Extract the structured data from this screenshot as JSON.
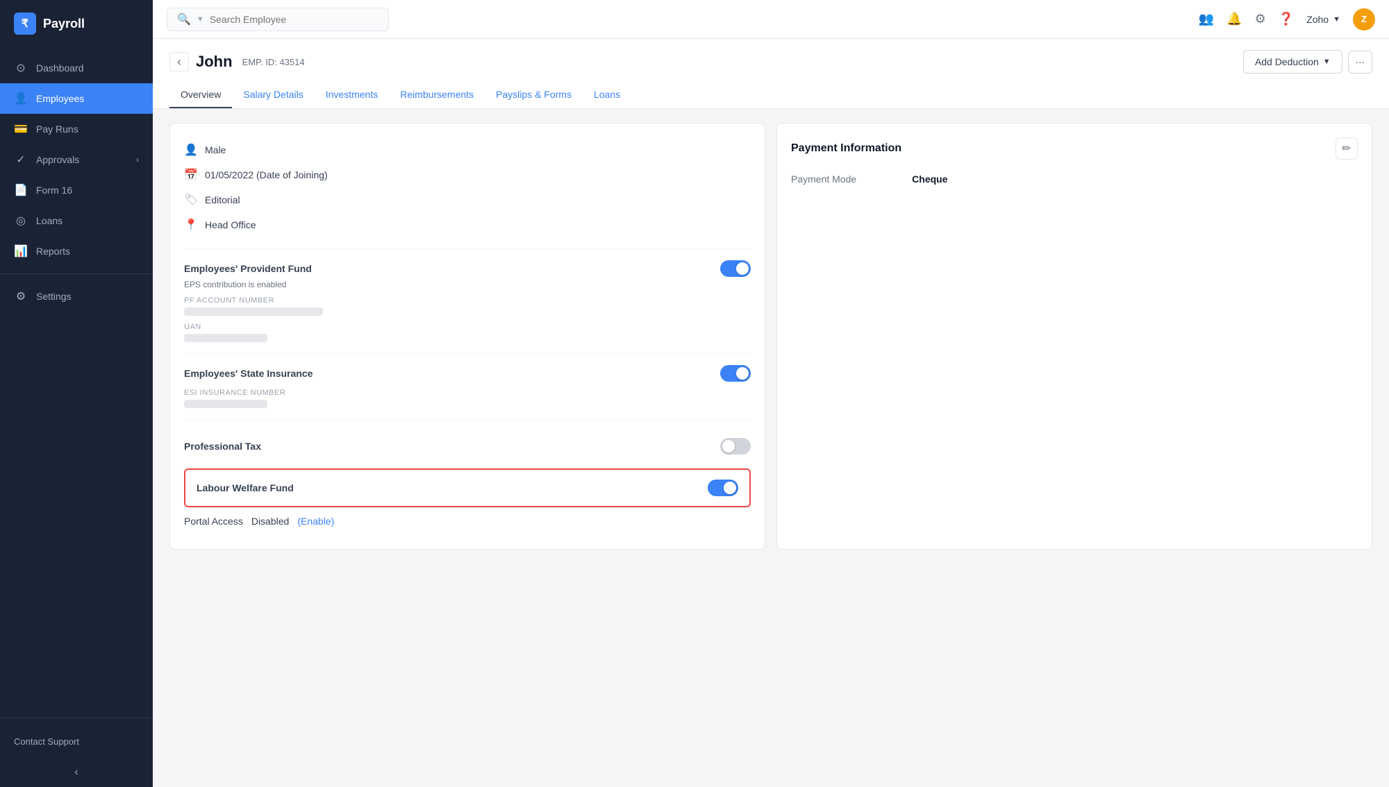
{
  "app": {
    "logo_text": "Payroll",
    "logo_icon": "₹"
  },
  "sidebar": {
    "items": [
      {
        "id": "dashboard",
        "label": "Dashboard",
        "icon": "⊙",
        "active": false
      },
      {
        "id": "employees",
        "label": "Employees",
        "icon": "👤",
        "active": true
      },
      {
        "id": "pay-runs",
        "label": "Pay Runs",
        "icon": "💳",
        "active": false
      },
      {
        "id": "approvals",
        "label": "Approvals",
        "icon": "✓",
        "active": false,
        "has_arrow": true
      },
      {
        "id": "form-16",
        "label": "Form 16",
        "icon": "📄",
        "active": false
      },
      {
        "id": "loans",
        "label": "Loans",
        "icon": "◎",
        "active": false
      },
      {
        "id": "reports",
        "label": "Reports",
        "icon": "📊",
        "active": false
      },
      {
        "id": "settings",
        "label": "Settings",
        "icon": "⚙",
        "active": false
      }
    ],
    "contact_support": "Contact Support",
    "collapse_icon": "‹"
  },
  "topbar": {
    "search_placeholder": "Search Employee",
    "user_label": "Zoho",
    "user_avatar": "Z"
  },
  "employee": {
    "name": "John",
    "emp_id_label": "EMP. ID: 43514",
    "back_icon": "‹"
  },
  "header_actions": {
    "add_deduction_label": "Add Deduction",
    "more_icon": "···"
  },
  "tabs": [
    {
      "id": "overview",
      "label": "Overview",
      "active": true
    },
    {
      "id": "salary-details",
      "label": "Salary Details",
      "active": false
    },
    {
      "id": "investments",
      "label": "Investments",
      "active": false
    },
    {
      "id": "reimbursements",
      "label": "Reimbursements",
      "active": false
    },
    {
      "id": "payslips",
      "label": "Payslips & Forms",
      "active": false
    },
    {
      "id": "loans",
      "label": "Loans",
      "active": false
    }
  ],
  "info_section": {
    "gender": "Male",
    "date_of_joining": "01/05/2022 (Date of Joining)",
    "department": "Editorial",
    "location": "Head Office"
  },
  "epf": {
    "label": "Employees' Provident Fund",
    "enabled": true,
    "sub_text": "EPS contribution is enabled",
    "pf_account_label": "PF ACCOUNT NUMBER",
    "uan_label": "UAN"
  },
  "esi": {
    "label": "Employees' State Insurance",
    "enabled": true,
    "esi_insurance_label": "ESI INSURANCE NUMBER"
  },
  "professional_tax": {
    "label": "Professional Tax",
    "enabled": false
  },
  "labour_welfare_fund": {
    "label": "Labour Welfare Fund",
    "enabled": true
  },
  "portal_access": {
    "label": "Portal Access",
    "status": "Disabled",
    "enable_text": "(Enable)"
  },
  "payment_information": {
    "title": "Payment Information",
    "payment_mode_label": "Payment Mode",
    "payment_mode_value": "Cheque",
    "edit_icon": "✏"
  }
}
